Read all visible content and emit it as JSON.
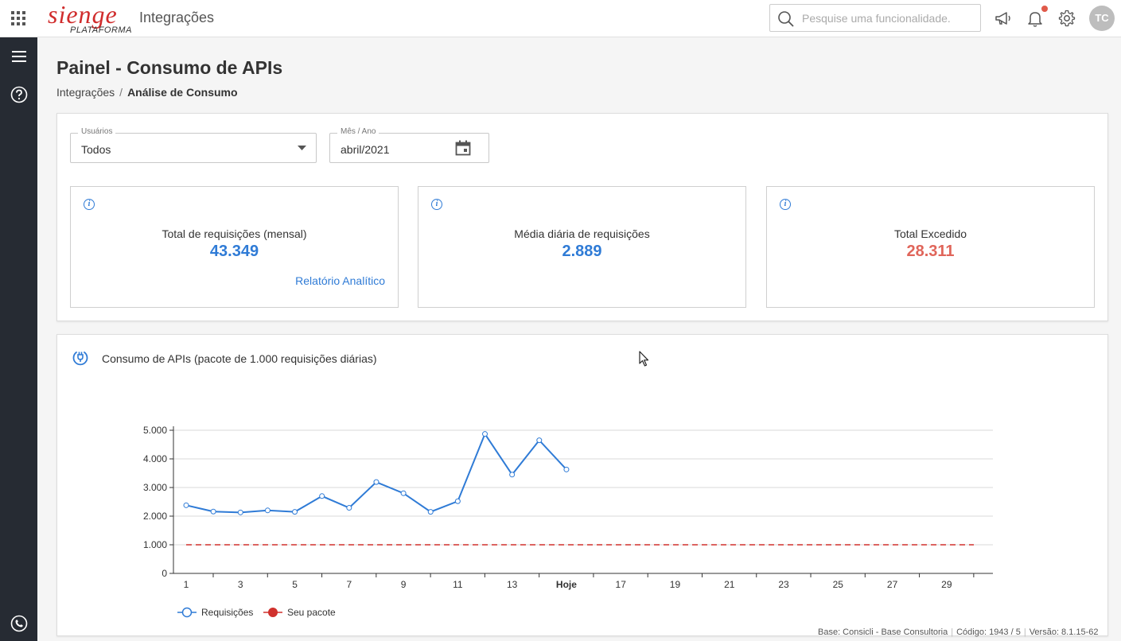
{
  "topbar": {
    "logo_text": "sienge",
    "logo_sub": "PLATAFORMA",
    "app_title": "Integrações",
    "search_placeholder": "Pesquise uma funcionalidade.",
    "avatar_initials": "TC"
  },
  "page": {
    "title": "Painel - Consumo de APIs",
    "breadcrumb": {
      "parent": "Integrações",
      "separator": "/",
      "current": "Análise de Consumo"
    }
  },
  "filters": {
    "users": {
      "label": "Usuários",
      "value": "Todos"
    },
    "month": {
      "label": "Mês / Ano",
      "value": "abril/2021"
    }
  },
  "cards": [
    {
      "label": "Total de requisições (mensal)",
      "value": "43.349",
      "color": "#2f7bd6",
      "link": "Relatório Analítico"
    },
    {
      "label": "Média diária de requisições",
      "value": "2.889",
      "color": "#2f7bd6"
    },
    {
      "label": "Total Excedido",
      "value": "28.311",
      "color": "#e0655a"
    }
  ],
  "chart_panel": {
    "title": "Consumo de APIs (pacote de 1.000 requisições diárias)"
  },
  "chart_data": {
    "type": "line",
    "ylim": [
      0,
      5000
    ],
    "y_ticks": [
      0,
      1000,
      2000,
      3000,
      4000,
      5000
    ],
    "y_tick_labels": [
      "0",
      "1.000",
      "2.000",
      "3.000",
      "4.000",
      "5.000"
    ],
    "x_range": [
      1,
      30
    ],
    "x_ticks": [
      1,
      3,
      5,
      7,
      9,
      11,
      13,
      15,
      17,
      19,
      21,
      23,
      25,
      27,
      29
    ],
    "x_tick_labels": [
      "1",
      "3",
      "5",
      "7",
      "9",
      "11",
      "13",
      "Hoje",
      "17",
      "19",
      "21",
      "23",
      "25",
      "27",
      "29"
    ],
    "grid": "horizontal",
    "legend": "bottom-left",
    "series": [
      {
        "name": "Requisições",
        "color": "#2f7bd6",
        "x": [
          1,
          2,
          3,
          4,
          5,
          6,
          7,
          8,
          9,
          10,
          11,
          12,
          13,
          14,
          15
        ],
        "values": [
          2380,
          2160,
          2130,
          2200,
          2150,
          2700,
          2290,
          3190,
          2800,
          2150,
          2520,
          4870,
          3450,
          4650,
          3630
        ]
      },
      {
        "name": "Seu pacote",
        "color": "#d0312d",
        "x": [
          1,
          30
        ],
        "values": [
          1000,
          1000
        ]
      }
    ]
  },
  "footer": {
    "base": "Base: Consicli - Base Consultoria",
    "code": "Código: 1943 / 5",
    "version": "Versão: 8.1.15-62"
  }
}
